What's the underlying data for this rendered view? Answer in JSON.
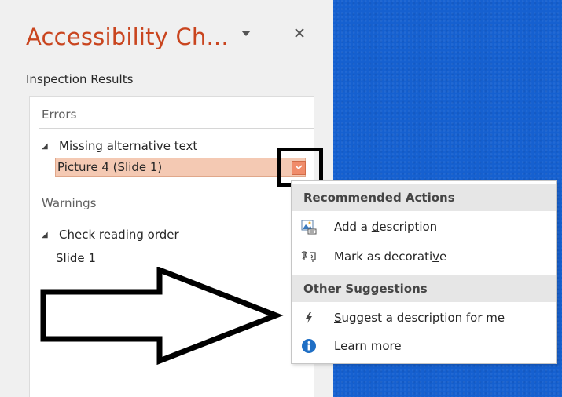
{
  "pane": {
    "title": "Accessibility Ch...",
    "inspection_label": "Inspection Results",
    "errors_header": "Errors",
    "error_group": "Missing alternative text",
    "error_item": "Picture 4  (Slide 1)",
    "warnings_header": "Warnings",
    "warning_group": "Check reading order",
    "warning_item": "Slide 1"
  },
  "menu": {
    "recommended_header": "Recommended Actions",
    "other_header": "Other Suggestions",
    "items": [
      {
        "pre": "Add a ",
        "key": "d",
        "post": "escription",
        "icon": "picture-description-icon"
      },
      {
        "pre": "Mark as decorati",
        "key": "v",
        "post": "e",
        "icon": "decorative-icon"
      },
      {
        "pre": "",
        "key": "S",
        "post": "uggest a description for me",
        "icon": "lightning-icon"
      },
      {
        "pre": "Learn ",
        "key": "m",
        "post": "ore",
        "icon": "info-icon"
      }
    ]
  },
  "colors": {
    "title": "#c9451f",
    "selection": "#f4c9b3",
    "slide_background": "#1560d0",
    "info_icon": "#1f6fc5"
  }
}
